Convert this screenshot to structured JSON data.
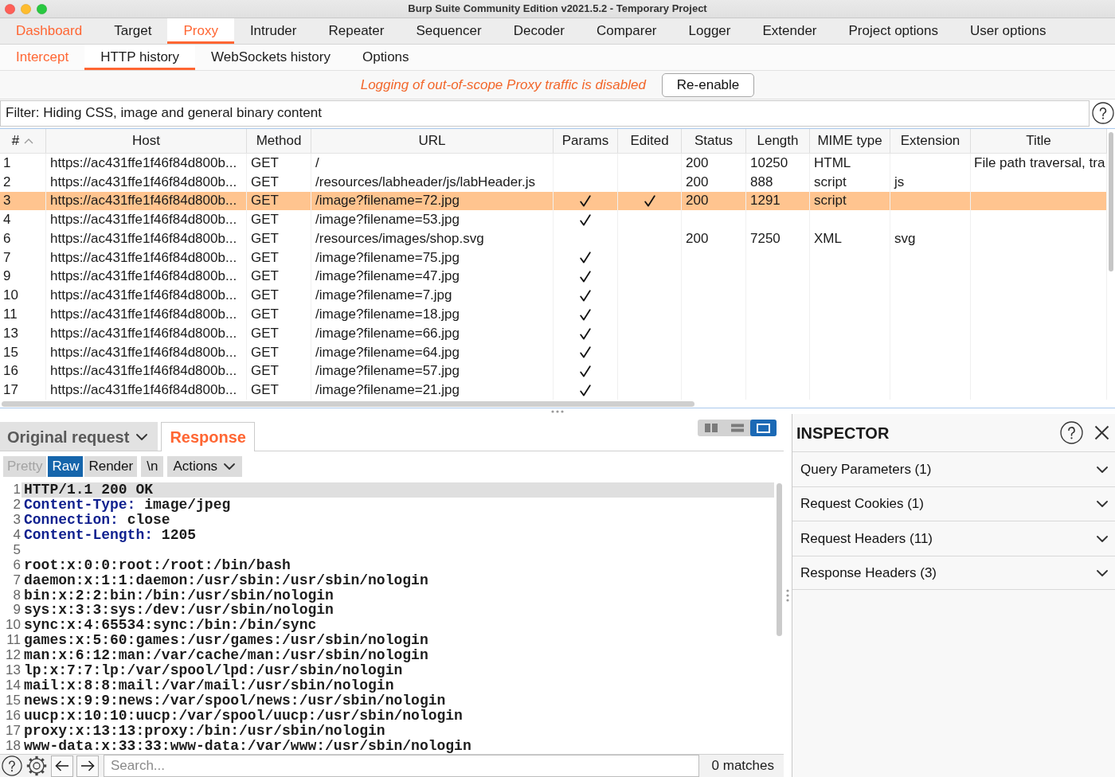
{
  "window": {
    "title": "Burp Suite Community Edition v2021.5.2 - Temporary Project"
  },
  "main_tabs": [
    {
      "label": "Dashboard",
      "selected": false,
      "highlighted": true
    },
    {
      "label": "Target",
      "selected": false,
      "highlighted": false
    },
    {
      "label": "Proxy",
      "selected": true,
      "highlighted": false
    },
    {
      "label": "Intruder",
      "selected": false,
      "highlighted": false
    },
    {
      "label": "Repeater",
      "selected": false,
      "highlighted": false
    },
    {
      "label": "Sequencer",
      "selected": false,
      "highlighted": false
    },
    {
      "label": "Decoder",
      "selected": false,
      "highlighted": false
    },
    {
      "label": "Comparer",
      "selected": false,
      "highlighted": false
    },
    {
      "label": "Logger",
      "selected": false,
      "highlighted": false
    },
    {
      "label": "Extender",
      "selected": false,
      "highlighted": false
    },
    {
      "label": "Project options",
      "selected": false,
      "highlighted": false
    },
    {
      "label": "User options",
      "selected": false,
      "highlighted": false
    }
  ],
  "sub_tabs": [
    {
      "label": "Intercept",
      "selected": false,
      "highlighted": true
    },
    {
      "label": "HTTP history",
      "selected": true,
      "highlighted": false
    },
    {
      "label": "WebSockets history",
      "selected": false,
      "highlighted": false
    },
    {
      "label": "Options",
      "selected": false,
      "highlighted": false
    }
  ],
  "notice": {
    "message": "Logging of out-of-scope Proxy traffic is disabled",
    "button": "Re-enable"
  },
  "filter": {
    "text": "Filter: Hiding CSS, image and general binary content"
  },
  "table": {
    "columns": [
      {
        "label": "#",
        "sorted": true
      },
      {
        "label": "Host",
        "sorted": false
      },
      {
        "label": "Method",
        "sorted": false
      },
      {
        "label": "URL",
        "sorted": false
      },
      {
        "label": "Params",
        "sorted": false
      },
      {
        "label": "Edited",
        "sorted": false
      },
      {
        "label": "Status",
        "sorted": false
      },
      {
        "label": "Length",
        "sorted": false
      },
      {
        "label": "MIME type",
        "sorted": false
      },
      {
        "label": "Extension",
        "sorted": false
      },
      {
        "label": "Title",
        "sorted": false
      }
    ],
    "rows": [
      {
        "number": "1",
        "host": "https://ac431ffe1f46f84d800b...",
        "method": "GET",
        "url": "/",
        "params": false,
        "edited": false,
        "status": "200",
        "length": "10250",
        "mime_type": "HTML",
        "title": "File path traversal, tra",
        "selected": false
      },
      {
        "number": "2",
        "host": "https://ac431ffe1f46f84d800b...",
        "method": "GET",
        "url": "/resources/labheader/js/labHeader.js",
        "params": false,
        "edited": false,
        "status": "200",
        "length": "888",
        "mime_type": "script",
        "extension": "js",
        "selected": false
      },
      {
        "number": "3",
        "host": "https://ac431ffe1f46f84d800b...",
        "method": "GET",
        "url": "/image?filename=72.jpg",
        "params": true,
        "edited": true,
        "status": "200",
        "length": "1291",
        "mime_type": "script",
        "selected": true
      },
      {
        "number": "4",
        "host": "https://ac431ffe1f46f84d800b...",
        "method": "GET",
        "url": "/image?filename=53.jpg",
        "params": true,
        "edited": false,
        "selected": false
      },
      {
        "number": "6",
        "host": "https://ac431ffe1f46f84d800b...",
        "method": "GET",
        "url": "/resources/images/shop.svg",
        "params": false,
        "edited": false,
        "status": "200",
        "length": "7250",
        "mime_type": "XML",
        "extension": "svg",
        "selected": false
      },
      {
        "number": "7",
        "host": "https://ac431ffe1f46f84d800b...",
        "method": "GET",
        "url": "/image?filename=75.jpg",
        "params": true,
        "edited": false,
        "selected": false
      },
      {
        "number": "9",
        "host": "https://ac431ffe1f46f84d800b...",
        "method": "GET",
        "url": "/image?filename=47.jpg",
        "params": true,
        "edited": false,
        "selected": false
      },
      {
        "number": "10",
        "host": "https://ac431ffe1f46f84d800b...",
        "method": "GET",
        "url": "/image?filename=7.jpg",
        "params": true,
        "edited": false,
        "selected": false
      },
      {
        "number": "11",
        "host": "https://ac431ffe1f46f84d800b...",
        "method": "GET",
        "url": "/image?filename=18.jpg",
        "params": true,
        "edited": false,
        "selected": false
      },
      {
        "number": "13",
        "host": "https://ac431ffe1f46f84d800b...",
        "method": "GET",
        "url": "/image?filename=66.jpg",
        "params": true,
        "edited": false,
        "selected": false
      },
      {
        "number": "15",
        "host": "https://ac431ffe1f46f84d800b...",
        "method": "GET",
        "url": "/image?filename=64.jpg",
        "params": true,
        "edited": false,
        "selected": false
      },
      {
        "number": "16",
        "host": "https://ac431ffe1f46f84d800b...",
        "method": "GET",
        "url": "/image?filename=57.jpg",
        "params": true,
        "edited": false,
        "selected": false
      },
      {
        "number": "17",
        "host": "https://ac431ffe1f46f84d800b...",
        "method": "GET",
        "url": "/image?filename=21.jpg",
        "params": true,
        "edited": false,
        "selected": false
      }
    ]
  },
  "editor": {
    "message_tabs": [
      {
        "label": "Original request",
        "kind": "dropdown",
        "selected": false
      },
      {
        "label": "Response",
        "kind": "tab",
        "selected": true
      }
    ],
    "layout_modes": [
      {
        "kind": "columns",
        "selected": false
      },
      {
        "kind": "rows",
        "selected": false
      },
      {
        "kind": "single",
        "selected": true
      }
    ],
    "format_buttons": [
      {
        "label": "Pretty",
        "selected": false,
        "disabled": true
      },
      {
        "label": "Raw",
        "selected": true,
        "disabled": false
      },
      {
        "label": "Render",
        "selected": false,
        "disabled": false
      }
    ],
    "newline_button": {
      "label": "\\n"
    },
    "actions_menu": {
      "label": "Actions"
    },
    "lines": [
      {
        "number": "1",
        "kind": "text",
        "text": "HTTP/1.1 200 OK",
        "selected": true
      },
      {
        "number": "2",
        "kind": "header",
        "name": "Content-Type:",
        "value": "image/jpeg",
        "selected": false
      },
      {
        "number": "3",
        "kind": "header",
        "name": "Connection:",
        "value": "close",
        "selected": false
      },
      {
        "number": "4",
        "kind": "header",
        "name": "Content-Length:",
        "value": "1205",
        "selected": false
      },
      {
        "number": "5",
        "kind": "text",
        "selected": false
      },
      {
        "number": "6",
        "kind": "text",
        "text": "root:x:0:0:root:/root:/bin/bash",
        "selected": false
      },
      {
        "number": "7",
        "kind": "text",
        "text": "daemon:x:1:1:daemon:/usr/sbin:/usr/sbin/nologin",
        "selected": false
      },
      {
        "number": "8",
        "kind": "text",
        "text": "bin:x:2:2:bin:/bin:/usr/sbin/nologin",
        "selected": false
      },
      {
        "number": "9",
        "kind": "text",
        "text": "sys:x:3:3:sys:/dev:/usr/sbin/nologin",
        "selected": false
      },
      {
        "number": "10",
        "kind": "text",
        "text": "sync:x:4:65534:sync:/bin:/bin/sync",
        "selected": false
      },
      {
        "number": "11",
        "kind": "text",
        "text": "games:x:5:60:games:/usr/games:/usr/sbin/nologin",
        "selected": false
      },
      {
        "number": "12",
        "kind": "text",
        "text": "man:x:6:12:man:/var/cache/man:/usr/sbin/nologin",
        "selected": false
      },
      {
        "number": "13",
        "kind": "text",
        "text": "lp:x:7:7:lp:/var/spool/lpd:/usr/sbin/nologin",
        "selected": false
      },
      {
        "number": "14",
        "kind": "text",
        "text": "mail:x:8:8:mail:/var/mail:/usr/sbin/nologin",
        "selected": false
      },
      {
        "number": "15",
        "kind": "text",
        "text": "news:x:9:9:news:/var/spool/news:/usr/sbin/nologin",
        "selected": false
      },
      {
        "number": "16",
        "kind": "text",
        "text": "uucp:x:10:10:uucp:/var/spool/uucp:/usr/sbin/nologin",
        "selected": false
      },
      {
        "number": "17",
        "kind": "text",
        "text": "proxy:x:13:13:proxy:/bin:/usr/sbin/nologin",
        "selected": false
      },
      {
        "number": "18",
        "kind": "text",
        "text": "www-data:x:33:33:www-data:/var/www:/usr/sbin/nologin",
        "selected": false
      }
    ],
    "search": {
      "placeholder": "Search..."
    },
    "match_count": "0 matches"
  },
  "inspector": {
    "title": "INSPECTOR",
    "sections": [
      {
        "label": "Query Parameters (1)",
        "expanded": false
      },
      {
        "label": "Request Cookies (1)",
        "expanded": false
      },
      {
        "label": "Request Headers (11)",
        "expanded": false
      },
      {
        "label": "Response Headers (3)",
        "expanded": false
      }
    ]
  }
}
